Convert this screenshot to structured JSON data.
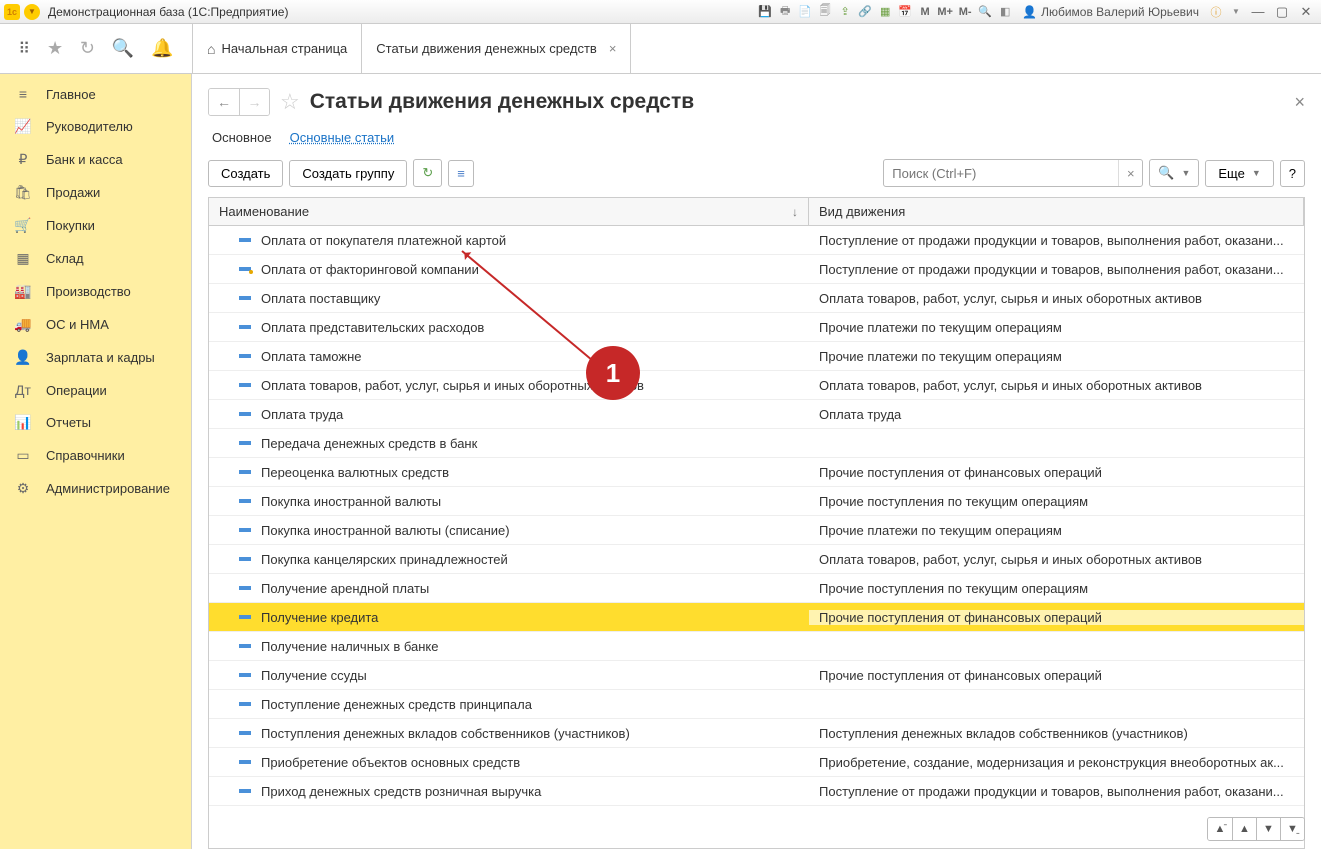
{
  "titlebar": {
    "title": "Демонстрационная база  (1С:Предприятие)",
    "m_labels": [
      "M",
      "M+",
      "M-"
    ],
    "user_name": "Любимов Валерий Юрьевич"
  },
  "tabs": {
    "home": "Начальная страница",
    "active": "Статьи движения денежных средств"
  },
  "sidebar": {
    "items": [
      {
        "icon": "≡",
        "label": "Главное"
      },
      {
        "icon": "📈",
        "label": "Руководителю"
      },
      {
        "icon": "₽",
        "label": "Банк и касса"
      },
      {
        "icon": "🛍",
        "label": "Продажи"
      },
      {
        "icon": "🛒",
        "label": "Покупки"
      },
      {
        "icon": "▦",
        "label": "Склад"
      },
      {
        "icon": "🏭",
        "label": "Производство"
      },
      {
        "icon": "🚚",
        "label": "ОС и НМА"
      },
      {
        "icon": "👤",
        "label": "Зарплата и кадры"
      },
      {
        "icon": "Дт",
        "label": "Операции"
      },
      {
        "icon": "📊",
        "label": "Отчеты"
      },
      {
        "icon": "▭",
        "label": "Справочники"
      },
      {
        "icon": "⚙",
        "label": "Администрирование"
      }
    ]
  },
  "page": {
    "title": "Статьи движения денежных средств",
    "subtabs": {
      "main": "Основное",
      "alt": "Основные статьи"
    },
    "buttons": {
      "create": "Создать",
      "create_group": "Создать группу",
      "more": "Еще"
    },
    "search_placeholder": "Поиск (Ctrl+F)"
  },
  "table": {
    "col1": "Наименование",
    "col2": "Вид движения",
    "rows": [
      {
        "name": "Оплата от покупателя платежной картой",
        "kind": "Поступление от продажи продукции и товаров, выполнения работ, оказани...",
        "dot": false
      },
      {
        "name": "Оплата от факторинговой компании",
        "kind": "Поступление от продажи продукции и товаров, выполнения работ, оказани...",
        "dot": true
      },
      {
        "name": "Оплата поставщику",
        "kind": "Оплата товаров, работ, услуг, сырья и иных оборотных активов",
        "dot": false
      },
      {
        "name": "Оплата представительских расходов",
        "kind": "Прочие платежи по текущим операциям",
        "dot": false
      },
      {
        "name": "Оплата таможне",
        "kind": "Прочие платежи по текущим операциям",
        "dot": false
      },
      {
        "name": "Оплата товаров, работ, услуг, сырья и иных оборотных активов",
        "kind": "Оплата товаров, работ, услуг, сырья и иных оборотных активов",
        "dot": false
      },
      {
        "name": "Оплата труда",
        "kind": "Оплата труда",
        "dot": false
      },
      {
        "name": "Передача денежных средств в банк",
        "kind": "",
        "dot": false
      },
      {
        "name": "Переоценка валютных средств",
        "kind": "Прочие поступления от финансовых операций",
        "dot": false
      },
      {
        "name": "Покупка иностранной валюты",
        "kind": "Прочие поступления по текущим операциям",
        "dot": false
      },
      {
        "name": "Покупка иностранной валюты (списание)",
        "kind": "Прочие платежи по текущим операциям",
        "dot": false
      },
      {
        "name": "Покупка канцелярских принадлежностей",
        "kind": "Оплата товаров, работ, услуг, сырья и иных оборотных активов",
        "dot": false
      },
      {
        "name": "Получение арендной платы",
        "kind": "Прочие поступления по текущим операциям",
        "dot": false
      },
      {
        "name": "Получение кредита",
        "kind": "Прочие поступления от финансовых операций",
        "dot": false,
        "highlight": true
      },
      {
        "name": "Получение наличных в банке",
        "kind": "",
        "dot": false
      },
      {
        "name": "Получение ссуды",
        "kind": "Прочие поступления от финансовых операций",
        "dot": false
      },
      {
        "name": "Поступление денежных средств принципала",
        "kind": "",
        "dot": false
      },
      {
        "name": "Поступления денежных вкладов собственников (участников)",
        "kind": "Поступления денежных вкладов собственников (участников)",
        "dot": false
      },
      {
        "name": "Приобретение объектов основных средств",
        "kind": "Приобретение, создание, модернизация и реконструкция внеоборотных ак...",
        "dot": false
      },
      {
        "name": "Приход денежных средств розничная выручка",
        "kind": "Поступление от продажи продукции и товаров, выполнения работ, оказани...",
        "dot": false
      }
    ]
  },
  "annotation": {
    "number": "1"
  }
}
